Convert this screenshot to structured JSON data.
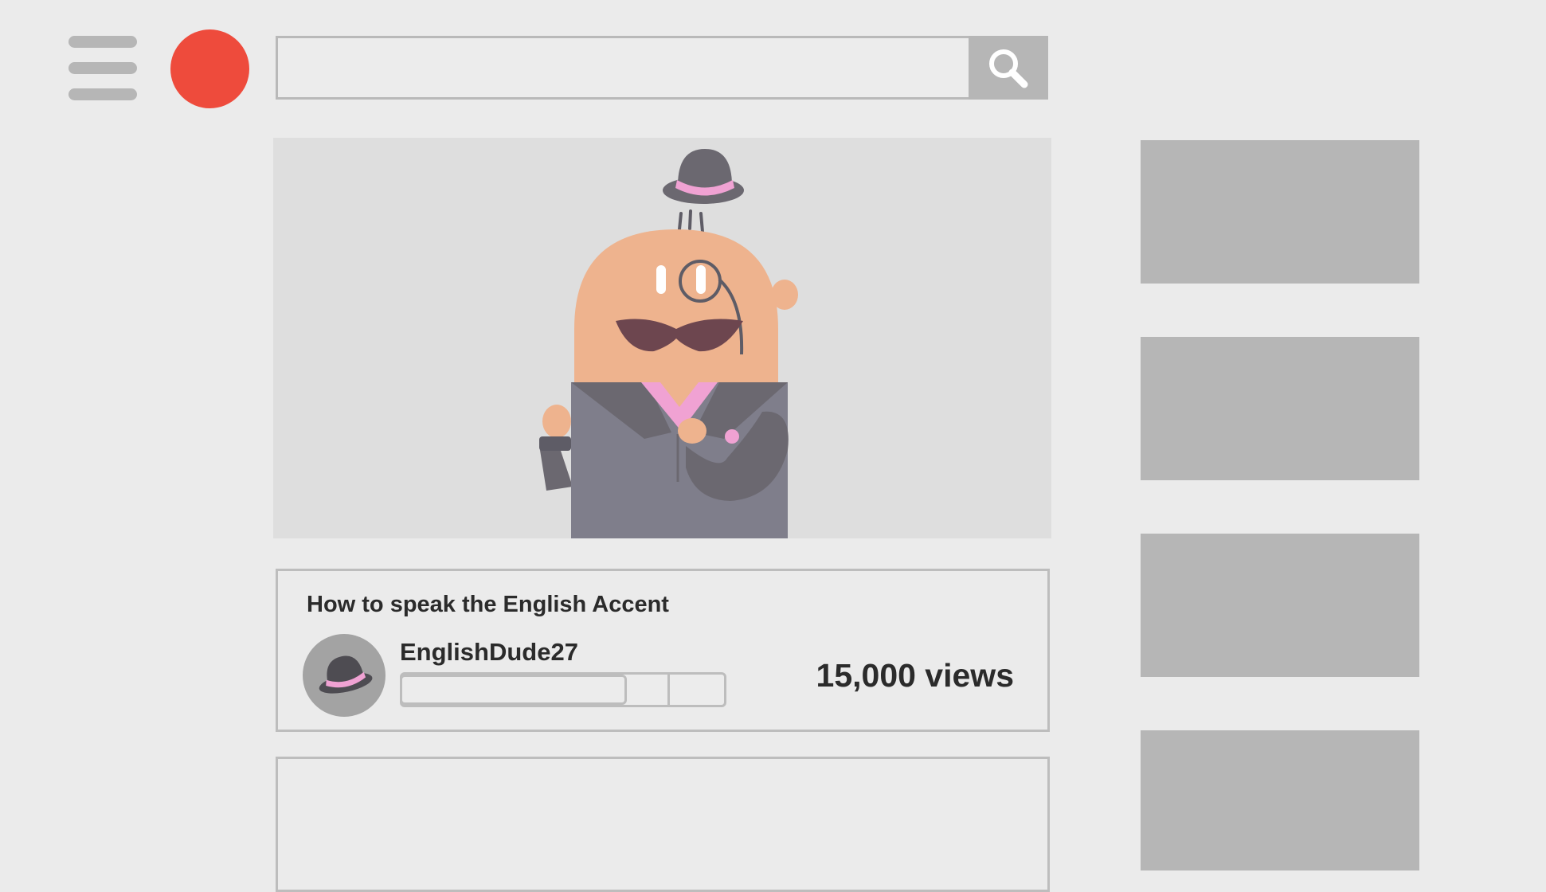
{
  "header": {
    "menu_icon": "hamburger-menu-icon",
    "logo_icon": "red-circle-logo-icon",
    "logo_color": "#ee4b3c",
    "search": {
      "value": "",
      "placeholder": ""
    },
    "search_button_icon": "search-icon"
  },
  "video": {
    "thumbnail_icon": "gentleman-character-illustration",
    "title": "How to speak the English Accent",
    "channel": {
      "name": "EnglishDude27",
      "avatar_icon": "bowler-hat-icon"
    },
    "views": "15,000 views"
  },
  "sidebar": {
    "related_count": 4
  },
  "colors": {
    "background": "#ebebeb",
    "placeholder_gray": "#b6b6b6",
    "skin": "#eeb38e",
    "suit": "#7f7e8b",
    "accent_pink": "#f0a2d3",
    "hat": "#6b6870",
    "mustache": "#6d464f"
  }
}
